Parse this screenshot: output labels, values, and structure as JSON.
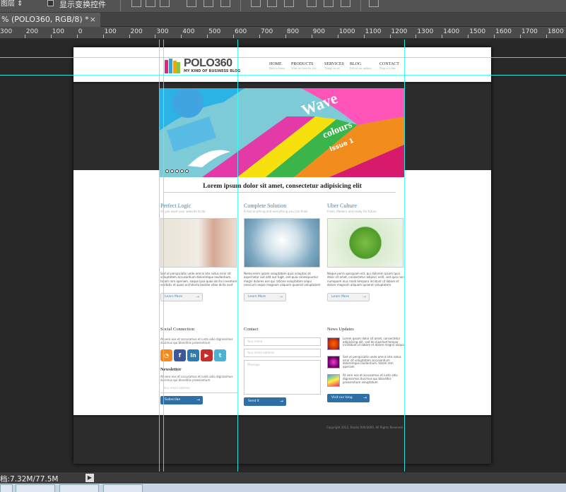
{
  "options_bar": {
    "mode_select": "图层",
    "checkbox_label": "显示变换控件"
  },
  "tab": {
    "title": "% (POLO360, RGB/8) *",
    "close": "×"
  },
  "ruler": {
    "labels": [
      "300",
      "200",
      "100",
      "0",
      "100",
      "200",
      "300",
      "400",
      "500",
      "600",
      "700",
      "800",
      "900",
      "1000",
      "1100",
      "1200",
      "1300",
      "1400",
      "1500",
      "1600",
      "1700",
      "1800"
    ]
  },
  "site": {
    "logo": {
      "name": "POLO360",
      "tagline": "MY KIND OF BUSINESS BLOG"
    },
    "nav": [
      {
        "label": "HOME",
        "sub": "Back to home"
      },
      {
        "label": "PRODUCTS",
        "sub": "What we have for you"
      },
      {
        "label": "SERVICES",
        "sub": "Things we do"
      },
      {
        "label": "BLOG",
        "sub": "Follow our updates"
      },
      {
        "label": "CONTACT",
        "sub": "Drop us a line"
      }
    ],
    "slider": {
      "title": "Wave",
      "subtitle": "colours",
      "issue": "issue 1"
    },
    "headline": "Lorem ipsum dolor sit amet, consectetur adipisicing elit",
    "features": [
      {
        "title": "Perfect Logic",
        "sub": "All you want your website to do",
        "body": "Sed ut perspiciatis unde omnis iste natus error sit voluptatem accusantium doloremque laudantium, totam rem aperiam, eaque ipsa quae ab illo inventore veritatis et quasi architecto beatae vitae dicta sunt",
        "button": "Learn More"
      },
      {
        "title": "Complete Solution",
        "sub": "A tool anything and everything you can think",
        "body": "Nemo enim ipsam voluptatem quia voluptas sit aspernatur aut odit aut fugit, sed quia consequuntur magni dolores eos qui ratione voluptatem sequi nesciunt neque magnam aliquam quaerat voluptatem",
        "button": "Learn More"
      },
      {
        "title": "Uber Culture",
        "sub": "Fresh, Modern and ready for future",
        "body": "Neque porro quisquam est, qui dolorem ipsum quia dolor sit amet, consectetur adipisci velit, sed quia non numquam eius modi tempora incidunt ut labore et dolore magnam aliquam quaerat voluptatem",
        "button": "Learn More"
      }
    ],
    "social": {
      "title": "Social Connection",
      "text": "At vero eos et accusamus et iusto odio dignissimos ducimus qui blanditiis praesentium"
    },
    "newsletter": {
      "title": "Newsletter",
      "text": "At vero eos et accusamus et iusto odio dignissimos ducimus qui blanditiis praesentium",
      "placeholder": "Your email address",
      "button": "Subscribe"
    },
    "contact": {
      "title": "Contact",
      "name_ph": "Your name",
      "email_ph": "Your email address",
      "msg_ph": "Message",
      "button": "Send it"
    },
    "news": {
      "title": "News Updates",
      "items": [
        "Lorem ipsum dolor sit amet, consectetur adipisicing elit, sed do eiusmod tempor incididunt ut labore et dolore magna aliqua",
        "Sed ut perspiciatis unde omnis iste natus error sit voluptatem accusantium doloremque laudantium, totam rem aperiam",
        "At vero eos et accusamus et iusto odio dignissimos ducimus qui blanditiis praesentium voluptatum"
      ],
      "button": "Visit our blog"
    },
    "copyright": "Copyright 2012, Studio XVII/3000, All Rights Reserved"
  },
  "status": {
    "doc": "档:7.32M/77.5M",
    "arrow": "▶"
  },
  "colors": {
    "accent": "#3f84b5",
    "guide": "#33ffff",
    "dark_band": "#2c2c2c"
  }
}
